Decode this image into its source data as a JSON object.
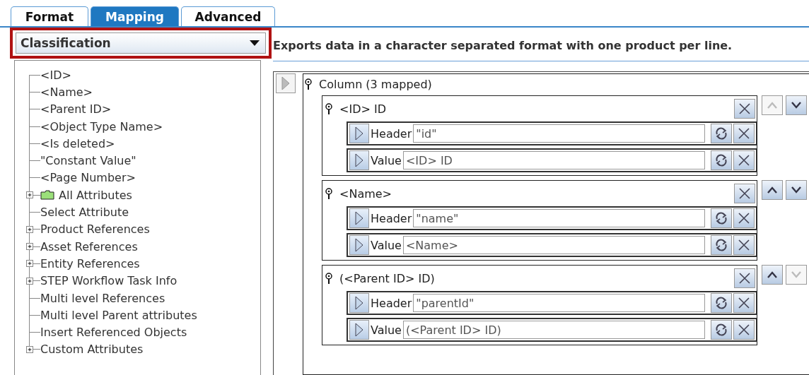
{
  "tabs": [
    {
      "label": "Format",
      "selected": false
    },
    {
      "label": "Mapping",
      "selected": true
    },
    {
      "label": "Advanced",
      "selected": false
    }
  ],
  "dropdown": {
    "value": "Classification",
    "highlighted": true
  },
  "tree": [
    {
      "label": "<ID>",
      "expandable": false,
      "kind": "item"
    },
    {
      "label": "<Name>",
      "expandable": false,
      "kind": "item"
    },
    {
      "label": "<Parent ID>",
      "expandable": false,
      "kind": "item"
    },
    {
      "label": "<Object Type Name>",
      "expandable": false,
      "kind": "item"
    },
    {
      "label": "<Is deleted>",
      "expandable": false,
      "kind": "item"
    },
    {
      "label": "\"Constant Value\"",
      "expandable": false,
      "kind": "item"
    },
    {
      "label": "<Page Number>",
      "expandable": false,
      "kind": "item"
    },
    {
      "label": "All Attributes",
      "expandable": true,
      "kind": "folder"
    },
    {
      "label": "Select Attribute",
      "expandable": false,
      "kind": "item"
    },
    {
      "label": "Product References",
      "expandable": true,
      "kind": "item"
    },
    {
      "label": "Asset References",
      "expandable": true,
      "kind": "item"
    },
    {
      "label": "Entity References",
      "expandable": true,
      "kind": "item"
    },
    {
      "label": "STEP Workflow Task Info",
      "expandable": true,
      "kind": "item"
    },
    {
      "label": "Multi level References",
      "expandable": false,
      "kind": "item"
    },
    {
      "label": "Multi level Parent attributes",
      "expandable": false,
      "kind": "item"
    },
    {
      "label": "Insert Referenced Objects",
      "expandable": false,
      "kind": "item"
    },
    {
      "label": "Custom Attributes",
      "expandable": true,
      "kind": "item"
    }
  ],
  "description": "Exports data in a character separated format with one product per line.",
  "column": {
    "title": "Column (3 mapped)",
    "mappings": [
      {
        "title": "<ID> ID",
        "up_disabled": true,
        "down_disabled": false,
        "fields": [
          {
            "label": "Header",
            "value": "\"id\""
          },
          {
            "label": "Value",
            "value": "<ID> ID"
          }
        ]
      },
      {
        "title": "<Name>",
        "up_disabled": false,
        "down_disabled": false,
        "fields": [
          {
            "label": "Header",
            "value": "\"name\""
          },
          {
            "label": "Value",
            "value": "<Name>"
          }
        ]
      },
      {
        "title": "(<Parent ID> ID)",
        "up_disabled": false,
        "down_disabled": true,
        "fields": [
          {
            "label": "Header",
            "value": "\"parentId\""
          },
          {
            "label": "Value",
            "value": "(<Parent ID> ID)"
          }
        ]
      }
    ]
  }
}
